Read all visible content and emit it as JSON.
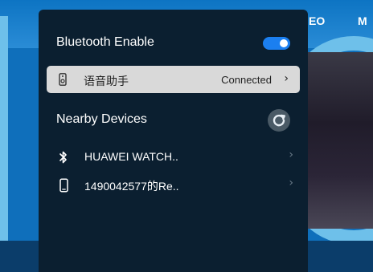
{
  "background": {
    "tabs": [
      "EO",
      "M"
    ]
  },
  "bluetooth": {
    "enable_label": "Bluetooth Enable",
    "enabled": true,
    "connected_device": {
      "name": "语音助手",
      "status": "Connected",
      "icon": "speaker-icon"
    },
    "nearby_label": "Nearby Devices",
    "nearby_devices": [
      {
        "name": "HUAWEI WATCH..",
        "icon": "bluetooth-icon"
      },
      {
        "name": "1490042577的Re..",
        "icon": "phone-icon"
      }
    ]
  },
  "colors": {
    "panel": "#0b1f30",
    "toggle_on": "#1b7ff0",
    "connected_row": "#d9d9d9"
  }
}
